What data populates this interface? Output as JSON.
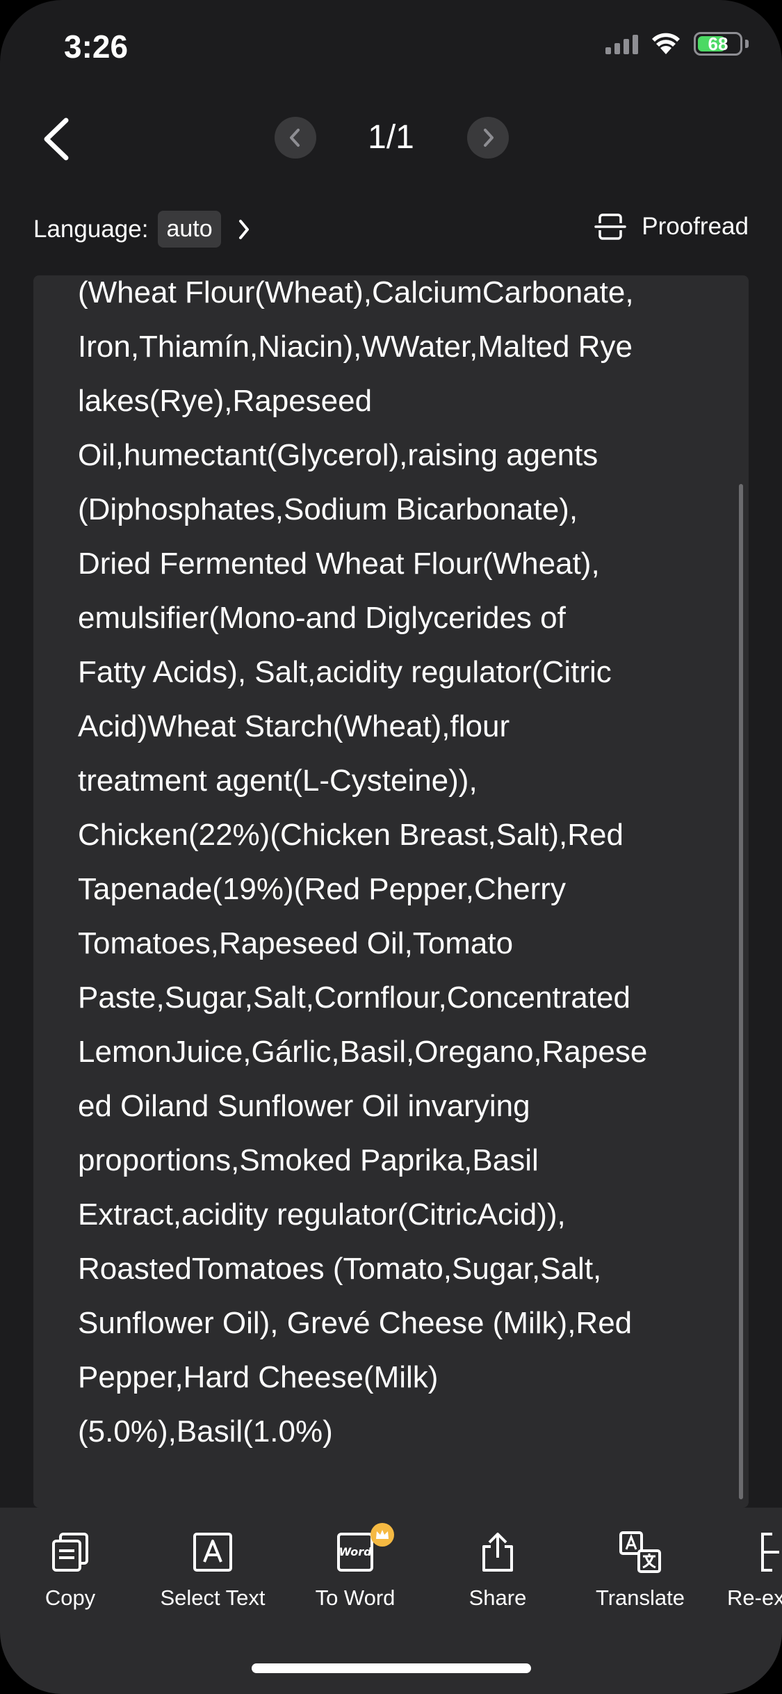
{
  "status_bar": {
    "time": "3:26",
    "battery": "68",
    "battery_level": 0.68
  },
  "nav": {
    "page_indicator": "1/1"
  },
  "language": {
    "label": "Language:",
    "value": "auto"
  },
  "proofread_label": "Proofread",
  "ocr_text": "(Wheat Flour(Wheat),CalciumCarbonate,\nIron,Thiamín,Niacin),WWater,Malted Rye\nlakes(Rye),Rapeseed\nOil,humectant(Glycerol),raising agents\n(Diphosphates,Sodium Bicarbonate),\nDried Fermented Wheat Flour(Wheat),\nemulsifier(Mono-and Diglycerides of\nFatty Acids), Salt,acidity regulator(Citric\nAcid)Wheat Starch(Wheat),flour\ntreatment agent(L-Cysteine)),\nChicken(22%)(Chicken Breast,Salt),Red\nTapenade(19%)(Red Pepper,Cherry\nTomatoes,Rapeseed Oil,Tomato\nPaste,Sugar,Salt,Cornflour,Concentrated\nLemonJuice,Gárlic,Basil,Oregano,Rapese\ned Oiland Sunflower Oil invarying\nproportions,Smoked Paprika,Basil\nExtract,acidity regulator(CitricAcid)),\nRoastedTomatoes (Tomato,Sugar,Salt,\nSunflower Oil), Grevé Cheese (Milk),Red\nPepper,Hard Cheese(Milk)\n(5.0%),Basil(1.0%)",
  "toolbar": {
    "copy": "Copy",
    "select_text": "Select Text",
    "to_word": "To Word",
    "to_word_icon_text": "Word",
    "share": "Share",
    "translate": "Translate",
    "re_extract": "Re-ex"
  },
  "colors": {
    "background": "#1c1c1e",
    "panel": "#2c2c2e",
    "premium": "#f5b942",
    "battery": "#4cd964"
  }
}
